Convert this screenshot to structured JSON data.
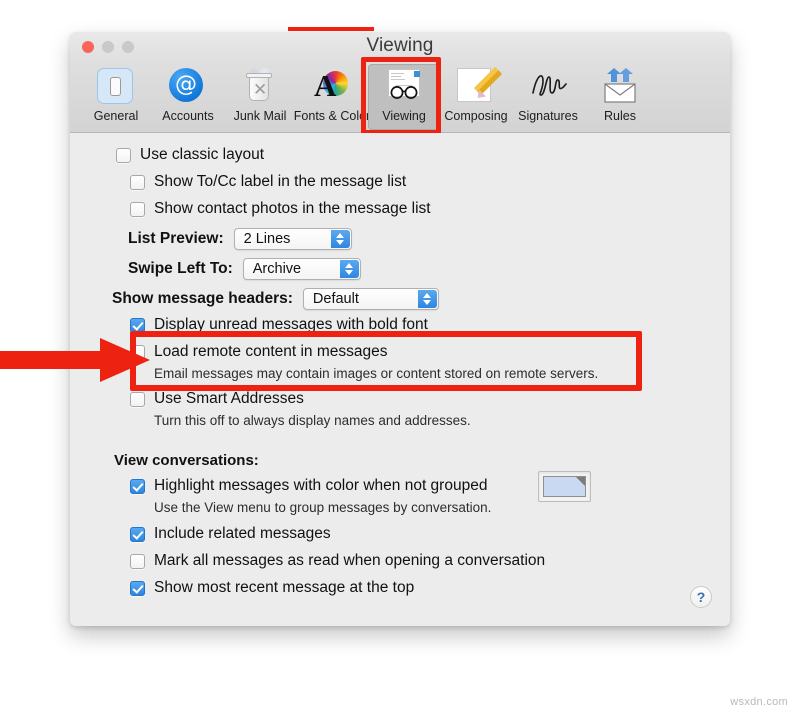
{
  "window": {
    "title": "Viewing",
    "traffic_lights": [
      "close",
      "minimize",
      "zoom"
    ]
  },
  "toolbar": {
    "items": [
      {
        "label": "General",
        "icon": "general-icon",
        "selected": false
      },
      {
        "label": "Accounts",
        "icon": "at-sign-icon",
        "selected": false
      },
      {
        "label": "Junk Mail",
        "icon": "trash-can-icon",
        "selected": false
      },
      {
        "label": "Fonts & Color",
        "icon": "color-wheel-a-icon",
        "selected": false
      },
      {
        "label": "Viewing",
        "icon": "eyeglasses-icon",
        "selected": true
      },
      {
        "label": "Composing",
        "icon": "pencil-paper-icon",
        "selected": false
      },
      {
        "label": "Signatures",
        "icon": "signature-icon",
        "selected": false
      },
      {
        "label": "Rules",
        "icon": "envelope-arrows-icon",
        "selected": false
      }
    ]
  },
  "settings": {
    "use_classic_layout": {
      "label": "Use classic layout",
      "checked": false
    },
    "show_to_cc_label": {
      "label": "Show To/Cc label in the message list",
      "checked": false
    },
    "show_contact_photos": {
      "label": "Show contact photos in the message list",
      "checked": false
    },
    "list_preview": {
      "label": "List Preview:",
      "value": "2 Lines"
    },
    "swipe_left_to": {
      "label": "Swipe Left To:",
      "value": "Archive"
    },
    "show_message_headers": {
      "label": "Show message headers:",
      "value": "Default"
    },
    "display_unread_bold": {
      "label": "Display unread messages with bold font",
      "checked": true
    },
    "load_remote_content": {
      "label": "Load remote content in messages",
      "description": "Email messages may contain images or content stored on remote servers.",
      "checked": false
    },
    "use_smart_addresses": {
      "label": "Use Smart Addresses",
      "description": "Turn this off to always display names and addresses.",
      "checked": false
    }
  },
  "conversations": {
    "heading": "View conversations:",
    "highlight_with_color": {
      "label": "Highlight messages with color when not grouped",
      "description": "Use the View menu to group messages by conversation.",
      "checked": true,
      "swatch_color": "#c9d9f2"
    },
    "include_related": {
      "label": "Include related messages",
      "checked": true
    },
    "mark_all_read": {
      "label": "Mark all messages as read when opening a conversation",
      "checked": false
    },
    "most_recent_top": {
      "label": "Show most recent message at the top",
      "checked": true
    }
  },
  "help_button": {
    "label": "?"
  },
  "annotations": {
    "accent_color": "#ee2211",
    "highlight_tab": "Viewing",
    "highlight_setting": "load_remote_content",
    "arrow_direction": "right"
  },
  "watermark": {
    "text": "wsxdn.com"
  }
}
